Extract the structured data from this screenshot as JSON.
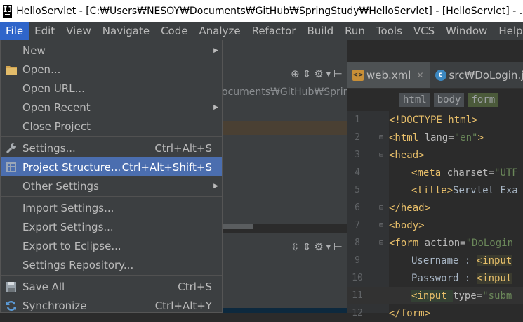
{
  "window": {
    "title": "HelloServlet - [C:₩Users₩NESOY₩Documents₩GitHub₩SpringStudy₩HelloServlet] - [HelloServlet] - ...₩we",
    "app_icon_text": "IJ"
  },
  "menubar": {
    "items": [
      "File",
      "Edit",
      "View",
      "Navigate",
      "Code",
      "Analyze",
      "Refactor",
      "Build",
      "Run",
      "Tools",
      "VCS",
      "Window",
      "Help"
    ],
    "active": "File"
  },
  "file_menu": {
    "items": [
      {
        "label": "New",
        "shortcut": "",
        "submenu": true,
        "icon": ""
      },
      {
        "label": "Open...",
        "shortcut": "",
        "submenu": false,
        "icon": "folder-icon"
      },
      {
        "label": "Open URL...",
        "shortcut": "",
        "submenu": false,
        "icon": ""
      },
      {
        "label": "Open Recent",
        "shortcut": "",
        "submenu": true,
        "icon": ""
      },
      {
        "label": "Close Project",
        "shortcut": "",
        "submenu": false,
        "icon": ""
      },
      {
        "label": "Settings...",
        "shortcut": "Ctrl+Alt+S",
        "submenu": false,
        "icon": "wrench-icon"
      },
      {
        "label": "Project Structure...",
        "shortcut": "Ctrl+Alt+Shift+S",
        "submenu": false,
        "icon": "project-structure-icon",
        "selected": true
      },
      {
        "label": "Other Settings",
        "shortcut": "",
        "submenu": true,
        "icon": ""
      },
      {
        "label": "Import Settings...",
        "shortcut": "",
        "submenu": false,
        "icon": ""
      },
      {
        "label": "Export Settings...",
        "shortcut": "",
        "submenu": false,
        "icon": ""
      },
      {
        "label": "Export to Eclipse...",
        "shortcut": "",
        "submenu": false,
        "icon": ""
      },
      {
        "label": "Settings Repository...",
        "shortcut": "",
        "submenu": false,
        "icon": ""
      },
      {
        "label": "Save All",
        "shortcut": "Ctrl+S",
        "submenu": false,
        "icon": "save-icon"
      },
      {
        "label": "Synchronize",
        "shortcut": "Ctrl+Alt+Y",
        "submenu": false,
        "icon": "sync-icon"
      }
    ]
  },
  "project_panel": {
    "path_fragment": "ocuments₩GitHub₩Sprin"
  },
  "editor": {
    "tabs": [
      {
        "label": "web.xml",
        "active": true
      },
      {
        "label": "src₩DoLogin.jav",
        "active": false
      }
    ],
    "breadcrumbs": [
      "html",
      "body",
      "form"
    ],
    "line_numbers": [
      "1",
      "2",
      "3",
      "4",
      "5",
      "6",
      "7",
      "8",
      "9",
      "10",
      "11",
      "12"
    ],
    "code": {
      "l1": "<!DOCTYPE html>",
      "l2_tag": "<html ",
      "l2_attr": "lang=",
      "l2_val": "\"en\"",
      "l2_end": ">",
      "l3": "<head>",
      "l4_tag": "<meta ",
      "l4_attr": "charset=",
      "l4_val": "\"UTF",
      "l5_tag": "<title>",
      "l5_text": "Servlet Exa",
      "l6": "</head>",
      "l7": "<body>",
      "l8_tag": "<form ",
      "l8_attr": "action=",
      "l8_val": "\"DoLogin",
      "l9_text": "Username : ",
      "l9_tag": "<input",
      "l10_text": "Password : ",
      "l10_tag": "<input",
      "l11_tag": "<input ",
      "l11_attr": "type=",
      "l11_val": "\"subm",
      "l12": "</form>"
    }
  }
}
